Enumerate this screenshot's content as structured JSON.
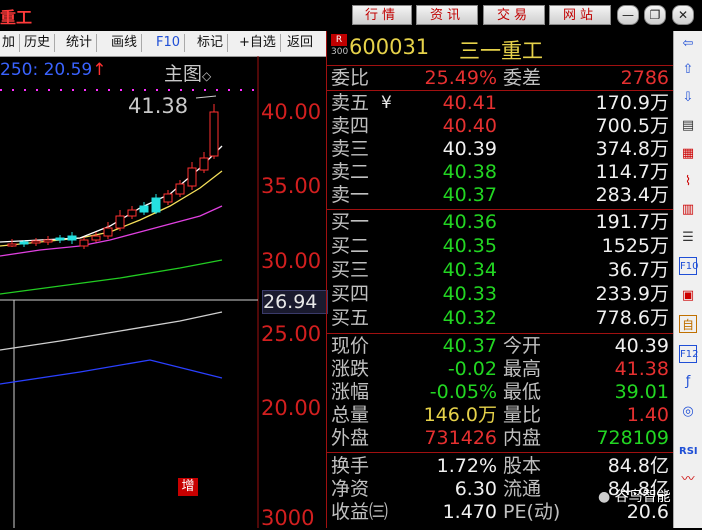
{
  "window": {
    "title_fragment": "重工",
    "buttons": [
      "行情",
      "资讯",
      "交易",
      "网站"
    ],
    "win_controls": [
      "minimize-icon",
      "restore-icon",
      "close-icon"
    ]
  },
  "toolbar": {
    "items": [
      "加",
      "历史",
      "统计",
      "画线",
      "F10",
      "标记",
      "+自选",
      "返回"
    ]
  },
  "chart": {
    "ma_label": "250: 20.59",
    "ma_arrow": "↑",
    "main_label": "主图",
    "high_label": "41.38",
    "price_labels": [
      "40.00",
      "35.00",
      "30.00",
      "25.00",
      "20.00",
      "3000"
    ],
    "current_price_tag": "26.94",
    "zeng_badge": "增",
    "colors": {
      "up": "#ff3030",
      "down": "#25e0e0",
      "ma5": "#ffffff",
      "ma10": "#f5e05a",
      "ma20": "#e040e0",
      "ma60": "#22cc22",
      "ma120": "#d0d0d0",
      "ma250": "#2a40ff"
    }
  },
  "quote": {
    "badge_top": "R",
    "badge_bottom": "300",
    "code": "600031",
    "name": "三一重工",
    "webi_label": "委比",
    "webi_value": "25.49%",
    "weicha_label": "委差",
    "weicha_value": "2786",
    "yen": "¥",
    "sell": [
      {
        "label": "卖五",
        "price": "40.41",
        "vol": "170.9万"
      },
      {
        "label": "卖四",
        "price": "40.40",
        "vol": "700.5万"
      },
      {
        "label": "卖三",
        "price": "40.39",
        "vol": "374.8万"
      },
      {
        "label": "卖二",
        "price": "40.38",
        "vol": "114.7万"
      },
      {
        "label": "卖一",
        "price": "40.37",
        "vol": "283.4万"
      }
    ],
    "buy": [
      {
        "label": "买一",
        "price": "40.36",
        "vol": "191.7万"
      },
      {
        "label": "买二",
        "price": "40.35",
        "vol": "1525万"
      },
      {
        "label": "买三",
        "price": "40.34",
        "vol": "36.7万"
      },
      {
        "label": "买四",
        "price": "40.33",
        "vol": "233.9万"
      },
      {
        "label": "买五",
        "price": "40.32",
        "vol": "778.6万"
      }
    ],
    "stats": [
      {
        "l1": "现价",
        "v1": "40.37",
        "l2": "今开",
        "v2": "40.39"
      },
      {
        "l1": "涨跌",
        "v1": "-0.02",
        "l2": "最高",
        "v2": "41.38"
      },
      {
        "l1": "涨幅",
        "v1": "-0.05%",
        "l2": "最低",
        "v2": "39.01"
      },
      {
        "l1": "总量",
        "v1": "146.0万",
        "l2": "量比",
        "v2": "1.40"
      },
      {
        "l1": "外盘",
        "v1": "731426",
        "l2": "内盘",
        "v2": "728109"
      }
    ],
    "stats2": [
      {
        "l1": "换手",
        "v1": "1.72%",
        "l2": "股本",
        "v2": "84.8亿"
      },
      {
        "l1": "净资",
        "v1": "6.30",
        "l2": "流通",
        "v2": "84.8亿"
      },
      {
        "l1": "收益㈢",
        "v1": "1.470",
        "l2": "PE(动)",
        "v2": "20.6"
      }
    ]
  },
  "sidebar": {
    "icons": [
      "arrow-left-icon",
      "arrow-up-icon",
      "arrow-down-icon",
      "doc-check-icon",
      "grid-icon",
      "line-chart-icon",
      "candle-icon",
      "list-icon",
      "f10-icon",
      "report-icon",
      "self-icon",
      "f12-icon",
      "function-icon",
      "circle-icon",
      "rsi-icon",
      "wave-icon"
    ],
    "labels": {
      "f10": "F10",
      "self": "自",
      "f12": "F12",
      "rsi": "RSI"
    }
  },
  "watermark": "谷鸟智能"
}
